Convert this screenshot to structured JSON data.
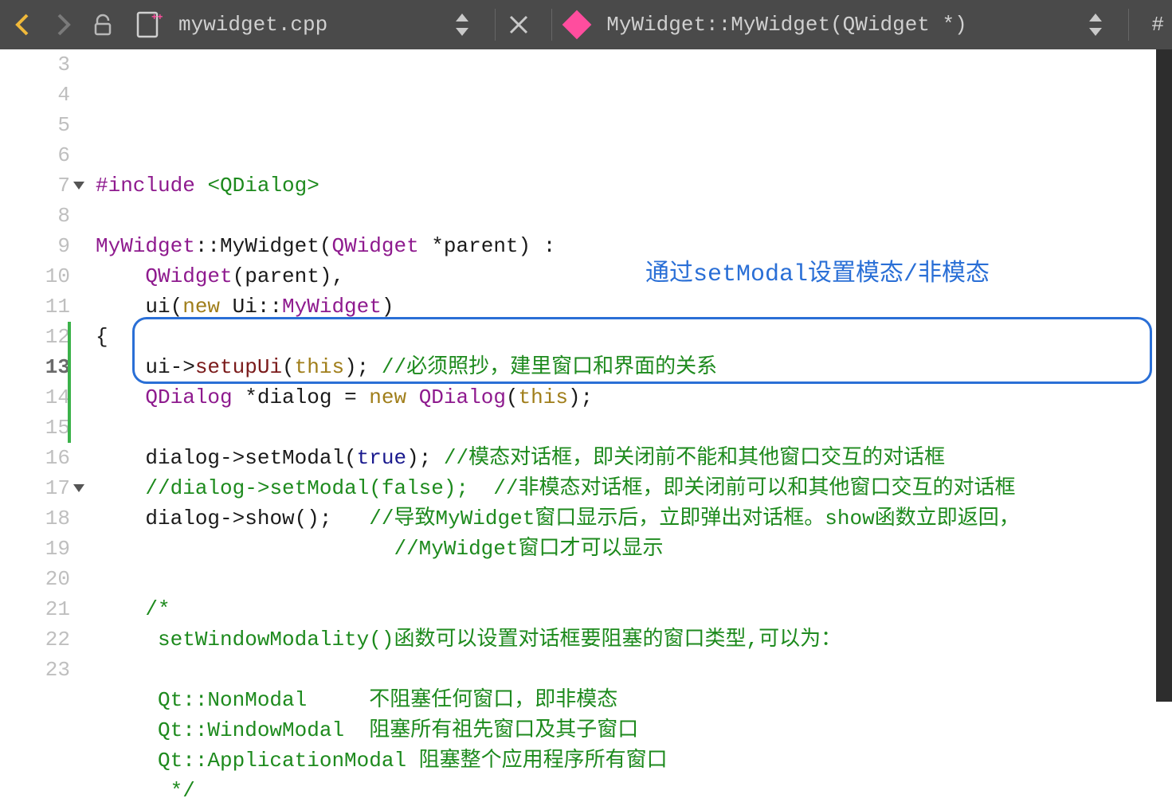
{
  "toolbar": {
    "file_name": "mywidget.cpp",
    "symbol": "MyWidget::MyWidget(QWidget *)",
    "right_extra": "#"
  },
  "editor": {
    "first_line_no": 3,
    "current_line_no": 13,
    "fold_lines": [
      7,
      17
    ],
    "change_bar": {
      "from": 12,
      "to": 15
    },
    "lines": [
      {
        "n": 3,
        "tokens": [
          {
            "t": "#include ",
            "c": "pp"
          },
          {
            "t": "<QDialog>",
            "c": "inc"
          }
        ]
      },
      {
        "n": 4,
        "tokens": []
      },
      {
        "n": 5,
        "tokens": [
          {
            "t": "MyWidget",
            "c": "type"
          },
          {
            "t": "::"
          },
          {
            "t": "MyWidget("
          },
          {
            "t": "QWidget",
            "c": "type"
          },
          {
            "t": " *parent) :"
          }
        ]
      },
      {
        "n": 6,
        "tokens": [
          {
            "t": "    "
          },
          {
            "t": "QWidget",
            "c": "type"
          },
          {
            "t": "(parent),"
          }
        ]
      },
      {
        "n": 7,
        "tokens": [
          {
            "t": "    ui("
          },
          {
            "t": "new",
            "c": "kw"
          },
          {
            "t": " Ui::"
          },
          {
            "t": "MyWidget",
            "c": "type"
          },
          {
            "t": ")"
          }
        ]
      },
      {
        "n": 8,
        "tokens": [
          {
            "t": "{"
          }
        ]
      },
      {
        "n": 9,
        "tokens": [
          {
            "t": "    ui->"
          },
          {
            "t": "setupUi",
            "c": "method"
          },
          {
            "t": "("
          },
          {
            "t": "this",
            "c": "kw"
          },
          {
            "t": "); "
          },
          {
            "t": "//必须照抄，建里窗口和界面的关系",
            "c": "cm"
          }
        ]
      },
      {
        "n": 10,
        "tokens": [
          {
            "t": "    "
          },
          {
            "t": "QDialog",
            "c": "type"
          },
          {
            "t": " *dialog = "
          },
          {
            "t": "new",
            "c": "kw"
          },
          {
            "t": " "
          },
          {
            "t": "QDialog",
            "c": "type"
          },
          {
            "t": "("
          },
          {
            "t": "this",
            "c": "kw"
          },
          {
            "t": ");"
          }
        ]
      },
      {
        "n": 11,
        "tokens": []
      },
      {
        "n": 12,
        "tokens": [
          {
            "t": "    dialog->"
          },
          {
            "t": "setModal"
          },
          {
            "t": "("
          },
          {
            "t": "true",
            "c": "bool"
          },
          {
            "t": "); "
          },
          {
            "t": "//模态对话框，即关闭前不能和其他窗口交互的对话框",
            "c": "cm"
          }
        ]
      },
      {
        "n": 13,
        "tokens": [
          {
            "t": "    "
          },
          {
            "t": "//dialog->setModal(false);  //非模态对话框，即关闭前可以和其他窗口交互的对话框",
            "c": "cm"
          }
        ]
      },
      {
        "n": 14,
        "tokens": [
          {
            "t": "    dialog->"
          },
          {
            "t": "show"
          },
          {
            "t": "();   "
          },
          {
            "t": "//导致MyWidget窗口显示后，立即弹出对话框。show函数立即返回，",
            "c": "cm"
          }
        ]
      },
      {
        "n": 15,
        "tokens": [
          {
            "t": "                        "
          },
          {
            "t": "//MyWidget窗口才可以显示",
            "c": "cm"
          }
        ]
      },
      {
        "n": 16,
        "tokens": []
      },
      {
        "n": 17,
        "tokens": [
          {
            "t": "    "
          },
          {
            "t": "/*",
            "c": "cm"
          }
        ]
      },
      {
        "n": 18,
        "tokens": [
          {
            "t": "     setWindowModality()函数可以设置对话框要阻塞的窗口类型,可以为：",
            "c": "cm"
          }
        ]
      },
      {
        "n": 19,
        "tokens": []
      },
      {
        "n": 20,
        "tokens": [
          {
            "t": "     Qt::NonModal     不阻塞任何窗口，即非模态",
            "c": "cm"
          }
        ]
      },
      {
        "n": 21,
        "tokens": [
          {
            "t": "     Qt::WindowModal  阻塞所有祖先窗口及其子窗口",
            "c": "cm"
          }
        ]
      },
      {
        "n": 22,
        "tokens": [
          {
            "t": "     Qt::ApplicationModal 阻塞整个应用程序所有窗口",
            "c": "cm"
          }
        ]
      },
      {
        "n": 23,
        "tokens": [
          {
            "t": "      */",
            "c": "cm"
          }
        ]
      }
    ]
  },
  "annotation": {
    "text": "通过setModal设置模态/非模态"
  }
}
